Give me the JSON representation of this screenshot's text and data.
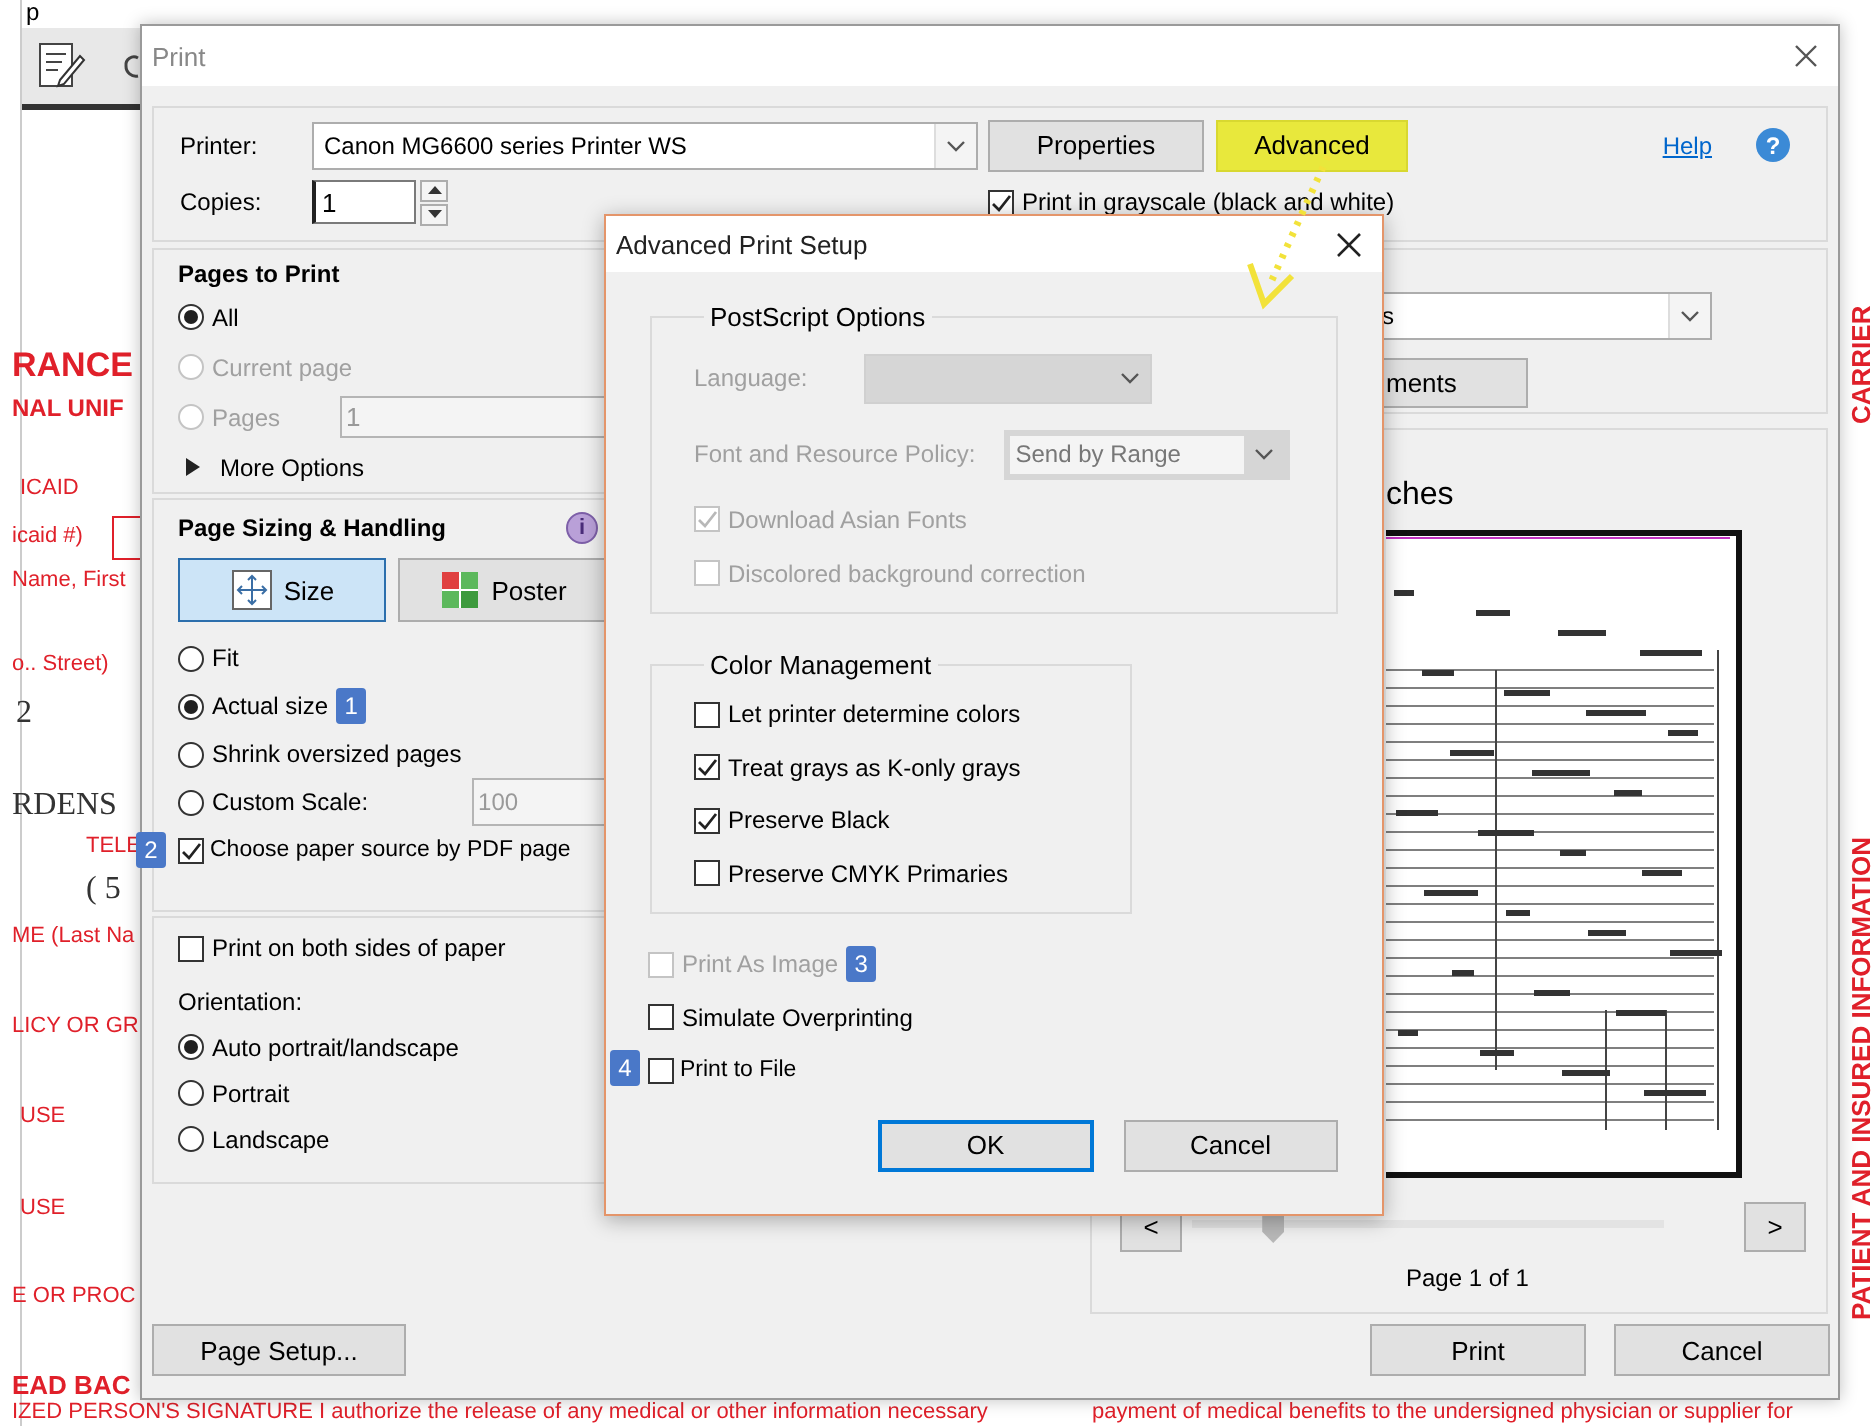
{
  "document_background": {
    "top_fragment": "p",
    "texts": [
      {
        "text": "RANCE",
        "kind": "heading"
      },
      {
        "text": "NAL UNIF",
        "kind": "subheading"
      },
      {
        "text": "ICAID",
        "kind": "label"
      },
      {
        "text": "icaid #)",
        "kind": "label"
      },
      {
        "text": "Name, First",
        "kind": "label"
      },
      {
        "text": "o.. Street)",
        "kind": "label"
      },
      {
        "text": "2",
        "kind": "value"
      },
      {
        "text": "RDENS",
        "kind": "value"
      },
      {
        "text": "TELE",
        "kind": "label"
      },
      {
        "text": "( 5",
        "kind": "value"
      },
      {
        "text": "ME (Last Na",
        "kind": "label"
      },
      {
        "text": "LICY OR GR",
        "kind": "label"
      },
      {
        "text": "USE",
        "kind": "label"
      },
      {
        "text": "USE",
        "kind": "label"
      },
      {
        "text": "E OR PROC",
        "kind": "label"
      },
      {
        "text": "EAD BAC",
        "kind": "bold"
      },
      {
        "text": "IZED PERSON'S SIGNATURE I authorize the release of any medical or other information necessary",
        "kind": "label"
      },
      {
        "text": "payment of medical benefits to the undersigned physician or supplier for",
        "kind": "label"
      }
    ],
    "side_texts": [
      "CARRIER",
      "PATIENT AND INSURED INFORMATION"
    ]
  },
  "print_dialog": {
    "title": "Print",
    "printer": {
      "label": "Printer:",
      "value": "Canon MG6600 series Printer WS"
    },
    "top_buttons": [
      {
        "label": "Properties",
        "highlighted": false
      },
      {
        "label": "Advanced",
        "highlighted": true
      }
    ],
    "help_link": "Help",
    "help_icon": "?",
    "copies": {
      "label": "Copies:",
      "value": "1"
    },
    "grayscale": {
      "label": "Print in grayscale (black and white)",
      "checked": true
    },
    "pages_to_print": {
      "title": "Pages to Print",
      "options": [
        {
          "label": "All",
          "selected": true,
          "disabled": false
        },
        {
          "label": "Current page",
          "selected": false,
          "disabled": true
        },
        {
          "label": "Pages",
          "selected": false,
          "disabled": true,
          "value": "1"
        }
      ],
      "more_options": "More Options"
    },
    "page_sizing": {
      "title": "Page Sizing & Handling",
      "info_icon": "i",
      "modes": [
        {
          "label": "Size",
          "selected": true
        },
        {
          "label": "Poster",
          "selected": false
        }
      ],
      "options": [
        {
          "label": "Fit",
          "selected": false
        },
        {
          "label": "Actual size",
          "selected": true,
          "badge": "1"
        },
        {
          "label": "Shrink oversized pages",
          "selected": false
        },
        {
          "label": "Custom Scale:",
          "selected": false,
          "value": "100"
        }
      ],
      "paper_source": {
        "label": "Choose paper source by PDF page",
        "checked": true,
        "badge": "2"
      }
    },
    "both_sides": {
      "label": "Print on both sides of paper",
      "checked": false
    },
    "orientation": {
      "label": "Orientation:",
      "options": [
        {
          "label": "Auto portrait/landscape",
          "selected": true
        },
        {
          "label": "Portrait",
          "selected": false
        },
        {
          "label": "Landscape",
          "selected": false
        }
      ]
    },
    "right_panel": {
      "dropdown_value": "s",
      "button_label": "ments",
      "heading": "ches",
      "prev": "<",
      "next": ">",
      "level": 0.17,
      "page_label": "Page 1 of 1"
    },
    "footer_left": "Page Setup...",
    "footer_right": [
      "Print",
      "Cancel"
    ]
  },
  "advanced_dialog": {
    "title": "Advanced Print Setup",
    "postscript": {
      "title": "PostScript Options",
      "language_label": "Language:",
      "policy_label": "Font and Resource Policy:",
      "policy_value": "Send by Range",
      "checks": [
        {
          "label": "Download Asian Fonts",
          "checked": true,
          "disabled": true
        },
        {
          "label": "Discolored background correction",
          "checked": false,
          "disabled": true
        }
      ]
    },
    "color_management": {
      "title": "Color Management",
      "checks": [
        {
          "label": "Let printer determine colors",
          "checked": false
        },
        {
          "label": "Treat grays as K-only grays",
          "checked": true
        },
        {
          "label": "Preserve Black",
          "checked": true
        },
        {
          "label": "Preserve CMYK Primaries",
          "checked": false
        }
      ]
    },
    "options": [
      {
        "label": "Print As Image",
        "checked": false,
        "disabled": true,
        "badge": "3"
      },
      {
        "label": "Simulate Overprinting",
        "checked": false,
        "disabled": false
      },
      {
        "label": "Print to File",
        "checked": false,
        "disabled": false,
        "badge": "4"
      }
    ],
    "buttons": [
      {
        "label": "OK",
        "focused": true
      },
      {
        "label": "Cancel",
        "focused": false
      }
    ]
  }
}
